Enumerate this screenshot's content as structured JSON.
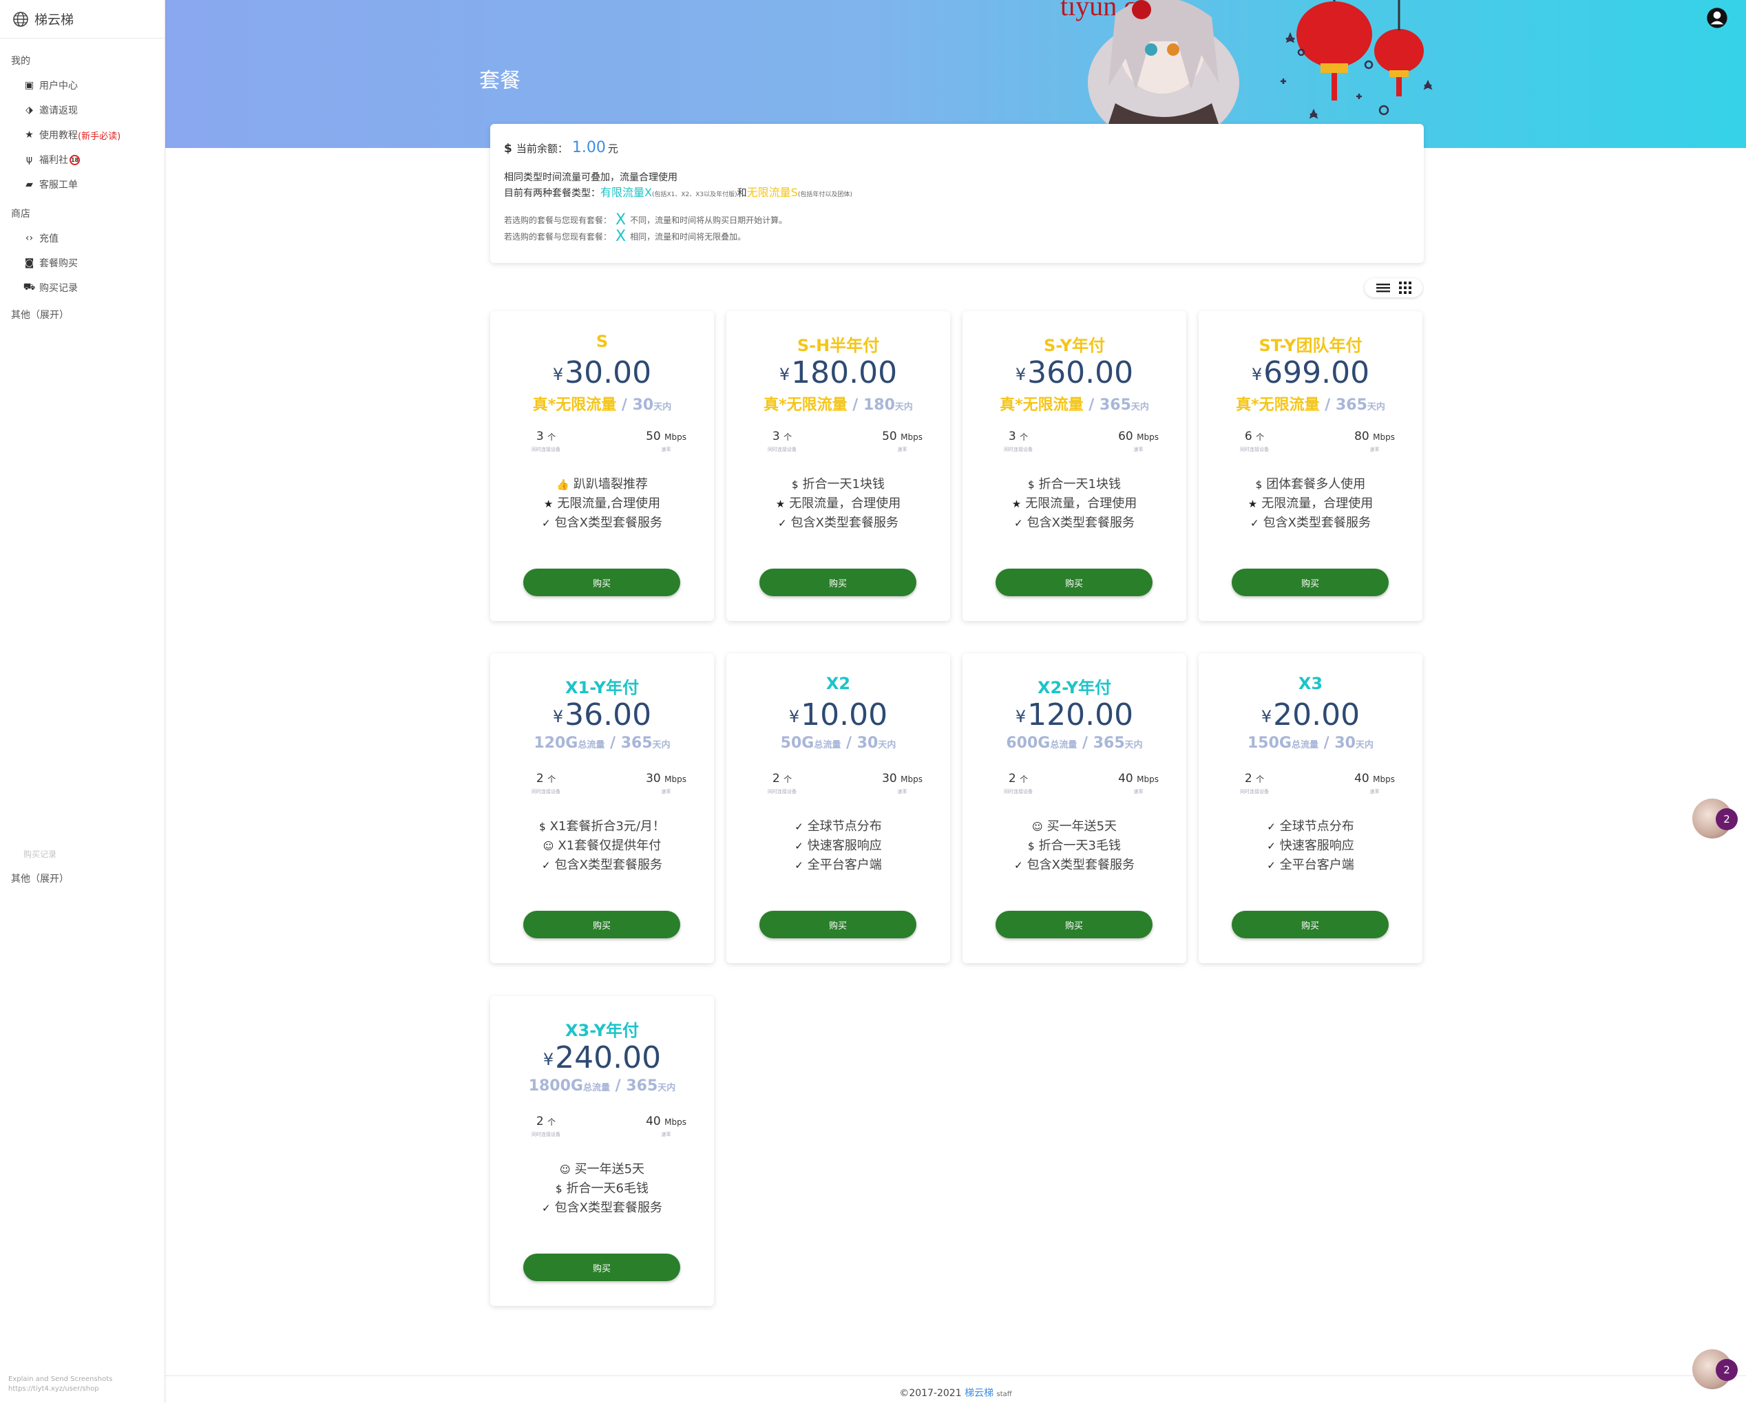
{
  "brand": {
    "name": "梯云梯"
  },
  "sidebar": {
    "sections": [
      {
        "label": "我的",
        "items": [
          {
            "label": "用户中心",
            "icon": "id-card-icon"
          },
          {
            "label": "邀请返现",
            "icon": "tag-icon"
          },
          {
            "label": "使用教程",
            "tag": "(新手必读)",
            "icon": "star-icon"
          },
          {
            "label": "福利社",
            "badge": "18",
            "icon": "cactus-icon"
          },
          {
            "label": "客服工单",
            "icon": "chat-icon"
          }
        ]
      },
      {
        "label": "商店",
        "items": [
          {
            "label": "充值",
            "icon": "code-icon"
          },
          {
            "label": "套餐购买",
            "icon": "camera-icon"
          },
          {
            "label": "购买记录",
            "icon": "cart-icon"
          }
        ]
      }
    ],
    "other_label": "其他（展开）",
    "ghost_item": "购买记录",
    "ghost_other_label": "其他（展开）",
    "watermark_line1": "Explain and Send Screenshots",
    "watermark_line2": "https://tiyt4.xyz/user/shop"
  },
  "header": {
    "title": "套餐",
    "art_text": "tiyun.cc"
  },
  "info": {
    "balance_label": "当前余额：",
    "balance_value": "1.00",
    "balance_unit": "元",
    "line1": "相同类型时间流量可叠加，流量合理使用",
    "line2_prefix": "目前有两种套餐类型：",
    "type_x": "有限流量X",
    "type_x_note": "(包括X1、X2、X3以及年付版)",
    "and": "和",
    "type_s": "无限流量S",
    "type_s_note": "(包括年付以及团体)",
    "rule1_prefix": "若选购的套餐与您现有套餐：",
    "rule1_suffix": "不同，流量和时间将从购买日期开始计算。",
    "rule2_prefix": "若选购的套餐与您现有套餐：",
    "rule2_suffix": "相同，流量和时间将无限叠加。",
    "x_mark": "X"
  },
  "labels": {
    "currency": "¥",
    "unlimited": "真*无限流量",
    "total_suffix": "总流量",
    "days_suffix": "天内",
    "devices_unit": "个",
    "devices_label": "同时连接设备",
    "speed_unit": "Mbps",
    "speed_label": "速率",
    "buy": "购买"
  },
  "plans": [
    {
      "name": "S",
      "kind": "s",
      "price": "30.00",
      "traffic": "",
      "days": "30",
      "devices": "3",
      "speed": "50",
      "features": [
        {
          "icon": "thumbs-up-icon",
          "glyph": "👍",
          "text": "趴趴墙裂推荐"
        },
        {
          "icon": "star-icon",
          "glyph": "★",
          "text": "无限流量,合理使用"
        },
        {
          "icon": "check-icon",
          "glyph": "✓",
          "text": "包含X类型套餐服务"
        }
      ]
    },
    {
      "name": "S-H半年付",
      "kind": "s",
      "price": "180.00",
      "traffic": "",
      "days": "180",
      "devices": "3",
      "speed": "50",
      "features": [
        {
          "icon": "dollar-icon",
          "glyph": "$",
          "text": "折合一天1块钱"
        },
        {
          "icon": "star-icon",
          "glyph": "★",
          "text": "无限流量，合理使用"
        },
        {
          "icon": "check-icon",
          "glyph": "✓",
          "text": "包含X类型套餐服务"
        }
      ]
    },
    {
      "name": "S-Y年付",
      "kind": "s",
      "price": "360.00",
      "traffic": "",
      "days": "365",
      "devices": "3",
      "speed": "60",
      "features": [
        {
          "icon": "dollar-icon",
          "glyph": "$",
          "text": "折合一天1块钱"
        },
        {
          "icon": "star-icon",
          "glyph": "★",
          "text": "无限流量，合理使用"
        },
        {
          "icon": "check-icon",
          "glyph": "✓",
          "text": "包含X类型套餐服务"
        }
      ]
    },
    {
      "name": "ST-Y团队年付",
      "kind": "s",
      "price": "699.00",
      "traffic": "",
      "days": "365",
      "devices": "6",
      "speed": "80",
      "features": [
        {
          "icon": "dollar-icon",
          "glyph": "$",
          "text": "团体套餐多人使用"
        },
        {
          "icon": "star-icon",
          "glyph": "★",
          "text": "无限流量，合理使用"
        },
        {
          "icon": "check-icon",
          "glyph": "✓",
          "text": "包含X类型套餐服务"
        }
      ]
    },
    {
      "name": "X1-Y年付",
      "kind": "x",
      "price": "36.00",
      "traffic": "120G",
      "days": "365",
      "devices": "2",
      "speed": "30",
      "features": [
        {
          "icon": "dollar-icon",
          "glyph": "$",
          "text": "X1套餐折合3元/月！"
        },
        {
          "icon": "smile-icon",
          "glyph": "☺",
          "text": "X1套餐仅提供年付"
        },
        {
          "icon": "check-icon",
          "glyph": "✓",
          "text": "包含X类型套餐服务"
        }
      ]
    },
    {
      "name": "X2",
      "kind": "x",
      "price": "10.00",
      "traffic": "50G",
      "days": "30",
      "devices": "2",
      "speed": "30",
      "features": [
        {
          "icon": "check-icon",
          "glyph": "✓",
          "text": "全球节点分布"
        },
        {
          "icon": "check-icon",
          "glyph": "✓",
          "text": "快速客服响应"
        },
        {
          "icon": "check-icon",
          "glyph": "✓",
          "text": "全平台客户端"
        }
      ]
    },
    {
      "name": "X2-Y年付",
      "kind": "x",
      "price": "120.00",
      "traffic": "600G",
      "days": "365",
      "devices": "2",
      "speed": "40",
      "features": [
        {
          "icon": "smile-icon",
          "glyph": "☺",
          "text": "买一年送5天"
        },
        {
          "icon": "dollar-icon",
          "glyph": "$",
          "text": "折合一天3毛钱"
        },
        {
          "icon": "check-icon",
          "glyph": "✓",
          "text": "包含X类型套餐服务"
        }
      ]
    },
    {
      "name": "X3",
      "kind": "x",
      "price": "20.00",
      "traffic": "150G",
      "days": "30",
      "devices": "2",
      "speed": "40",
      "features": [
        {
          "icon": "check-icon",
          "glyph": "✓",
          "text": "全球节点分布"
        },
        {
          "icon": "check-icon",
          "glyph": "✓",
          "text": "快速客服响应"
        },
        {
          "icon": "check-icon",
          "glyph": "✓",
          "text": "全平台客户端"
        }
      ]
    },
    {
      "name": "X3-Y年付",
      "kind": "x",
      "price": "240.00",
      "traffic": "1800G",
      "days": "365",
      "devices": "2",
      "speed": "40",
      "features": [
        {
          "icon": "smile-icon",
          "glyph": "☺",
          "text": "买一年送5天"
        },
        {
          "icon": "dollar-icon",
          "glyph": "$",
          "text": "折合一天6毛钱"
        },
        {
          "icon": "check-icon",
          "glyph": "✓",
          "text": "包含X类型套餐服务"
        }
      ]
    }
  ],
  "footer": {
    "copyright": "©2017-2021",
    "site": "梯云梯",
    "suffix": "staff"
  },
  "chat": {
    "unread": "2"
  },
  "colors": {
    "accent_gold": "#f5c518",
    "accent_cyan": "#1cc4c8",
    "buy_green": "#2a7f2a",
    "price_navy": "#2e4a73"
  }
}
